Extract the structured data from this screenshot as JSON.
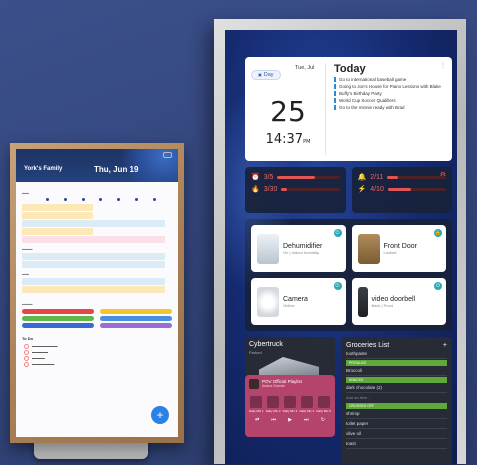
{
  "left_display": {
    "family_name": "York's Family",
    "date": "Thu, Jun 19",
    "fab_label": "+",
    "todo_title": "To Do"
  },
  "right_display": {
    "date_card": {
      "day_chip": "Day",
      "date": "Tue, Jul",
      "day_number": "25",
      "time": "14:37",
      "time_suffix": "PM",
      "today_title": "Today",
      "menu_icon": "⋮",
      "events": [
        {
          "text": "Go to international baseball game"
        },
        {
          "text": "Going to Jon's House for Piano Lessons with Blake"
        },
        {
          "text": "Buffy's Birthday Party"
        },
        {
          "text": "World Cup Soccer Qualifiers"
        },
        {
          "text": "Go to the minnie ready with Brad"
        }
      ]
    },
    "stats": [
      {
        "value": "3/5",
        "fill": 0.6
      },
      {
        "value": "3/30",
        "fill": 0.1
      },
      {
        "value": "2/11",
        "fill": 0.18
      },
      {
        "value": "4/10",
        "fill": 0.4
      }
    ],
    "devices": [
      {
        "name": "Dehumidifier",
        "sub": "On | Indoor humidity",
        "icon": "dehumidifier-icon"
      },
      {
        "name": "Front Door",
        "sub": "Locked",
        "icon": "door-icon"
      },
      {
        "name": "Camera",
        "sub": "Online",
        "icon": "camera-icon"
      },
      {
        "name": "video doorbell",
        "sub": "Back | Front",
        "icon": "doorbell-icon"
      }
    ],
    "tesla": {
      "name": "Cybertruck",
      "sub": "Parked",
      "icons": [
        "▢",
        "✚",
        "ϟ",
        "◐"
      ]
    },
    "groceries": {
      "title": "Groceries List",
      "add": "+",
      "items": [
        {
          "type": "item",
          "text": "toothpaste"
        },
        {
          "type": "section",
          "text": "PRODUCE"
        },
        {
          "type": "item",
          "text": "Broccoli"
        },
        {
          "type": "section",
          "text": "SNACKS"
        },
        {
          "type": "item",
          "text": "dark chocolate (2)"
        },
        {
          "type": "add",
          "text": "Add an item..."
        },
        {
          "type": "section",
          "text": "CROSSED OFF"
        },
        {
          "type": "item",
          "text": "shrimp"
        },
        {
          "type": "item",
          "text": "toilet paper"
        },
        {
          "type": "item",
          "text": "olive oil"
        },
        {
          "type": "item",
          "text": "toast"
        }
      ]
    },
    "music": {
      "title": "POV Official Playlist",
      "sub": "Ariana Grande",
      "mixes": [
        "Daily Mix 1",
        "Daily Mix 2",
        "Daily Mix 3",
        "Daily Mix 4",
        "Daily Mix 5"
      ],
      "controls": [
        "⇄",
        "⏮",
        "▶",
        "⏭",
        "↻"
      ]
    }
  }
}
